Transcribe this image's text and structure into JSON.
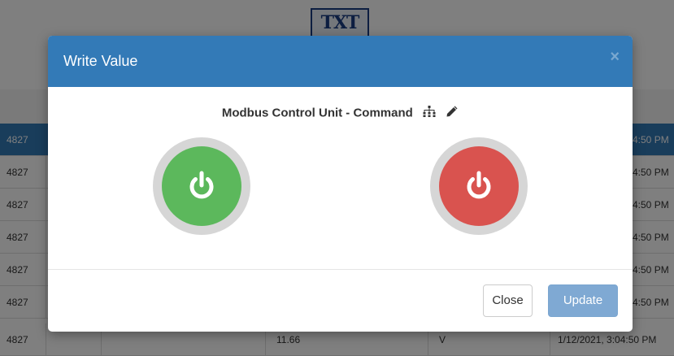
{
  "background": {
    "logo_text": "TXT",
    "rows": [
      {
        "id": "4827",
        "time": "4:50 PM",
        "selected": true
      },
      {
        "id": "4827",
        "time": "4:50 PM"
      },
      {
        "id": "4827",
        "time": "4:50 PM"
      },
      {
        "id": "4827",
        "time": "4:50 PM"
      },
      {
        "id": "4827",
        "time": "4:50 PM"
      },
      {
        "id": "4827",
        "time": "4:50 PM"
      },
      {
        "id": "4827",
        "value": "11.66",
        "unit": "V",
        "date": "1/12/2021, 3:04:50 PM"
      }
    ]
  },
  "modal": {
    "title": "Write Value",
    "close_symbol": "×",
    "unit_label": "Modbus Control Unit - Command",
    "icons": {
      "tree": "hierarchy-icon",
      "edit": "pencil-icon",
      "power_on": "power-on-icon",
      "power_off": "power-off-icon"
    },
    "colors": {
      "header": "#337ab7",
      "on_button": "#5cb85c",
      "off_button": "#d9534f",
      "update_button": "#7fa9d3"
    },
    "buttons": {
      "close": "Close",
      "update": "Update"
    }
  }
}
